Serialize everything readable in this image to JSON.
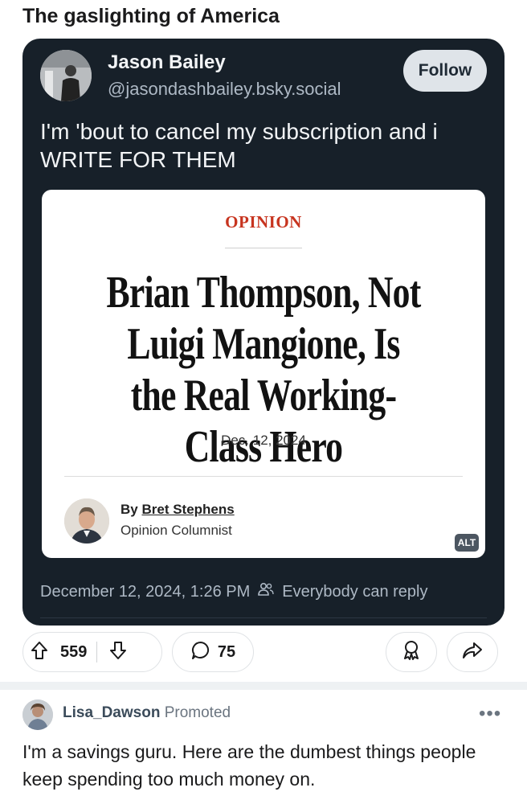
{
  "post": {
    "title": "The gaslighting of America"
  },
  "embed_post": {
    "author_name": "Jason Bailey",
    "author_handle": "@jasondashbailey.bsky.social",
    "follow_label": "Follow",
    "text": "I'm 'bout to cancel my subscription and i WRITE FOR THEM",
    "timestamp": "December 12, 2024, 1:26 PM",
    "reply_setting": "Everybody can reply",
    "article": {
      "section": "OPINION",
      "headline": "Brian Thompson, Not Luigi Mangione, Is the Real Working-Class Hero",
      "date": "Dec. 12, 2024",
      "byline_prefix": "By",
      "byline_author": "Bret Stephens",
      "byline_role": "Opinion Columnist",
      "alt_badge": "ALT"
    }
  },
  "actions": {
    "upvote_icon": "arrow-up-icon",
    "vote_count": "559",
    "downvote_icon": "arrow-down-icon",
    "comment_icon": "speech-bubble-icon",
    "comment_count": "75",
    "award_icon": "award-icon",
    "share_icon": "share-icon"
  },
  "promoted": {
    "username": "Lisa_Dawson",
    "promoted_label": "Promoted",
    "more_icon": "more-icon",
    "text": "I'm a savings guru. Here are the dumbest things people keep spending too much money on."
  },
  "colors": {
    "card_background": "#172029",
    "opinion_red": "#c7341f",
    "follow_button": "#dfe4e9"
  }
}
